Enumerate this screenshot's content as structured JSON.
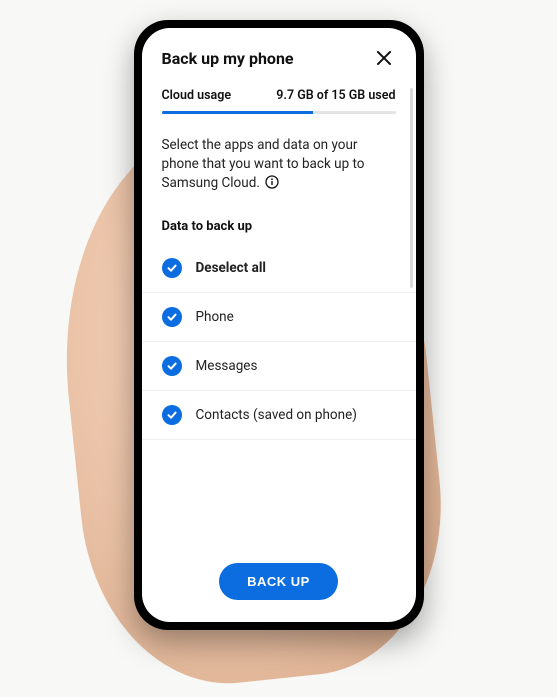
{
  "header": {
    "title": "Back up my phone"
  },
  "usage": {
    "label": "Cloud usage",
    "text": "9.7 GB of 15 GB used",
    "percent": 64.6
  },
  "intro": {
    "text": "Select the apps and data on your phone that you want to back up to Samsung Cloud."
  },
  "section_label": "Data to back up",
  "items": [
    {
      "label": "Deselect all",
      "checked": true
    },
    {
      "label": "Phone",
      "checked": true
    },
    {
      "label": "Messages",
      "checked": true
    },
    {
      "label": "Contacts (saved on phone)",
      "checked": true
    }
  ],
  "footer": {
    "backup_label": "BACK UP"
  },
  "colors": {
    "accent": "#0b6de0"
  }
}
